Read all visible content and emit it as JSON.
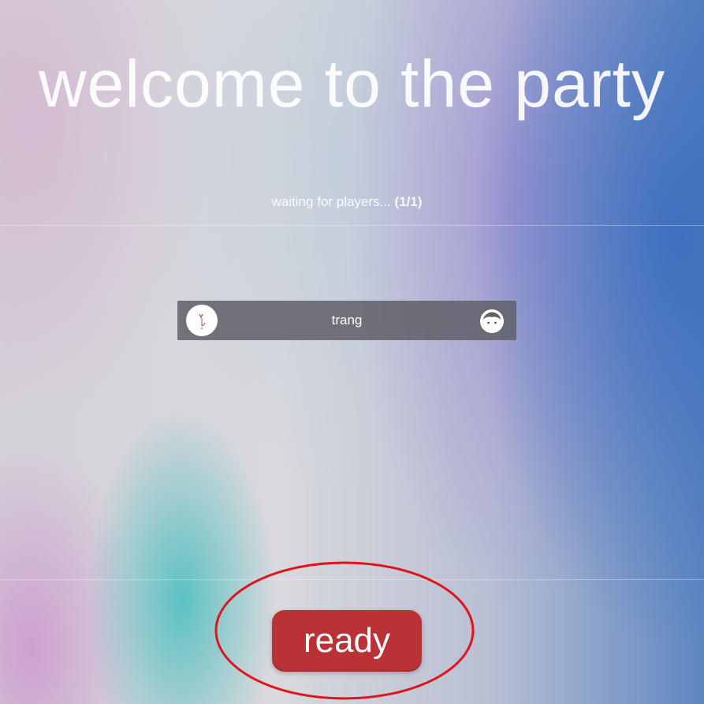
{
  "page": {
    "title": "welcome to the party"
  },
  "lobby": {
    "status_text": "waiting for players...",
    "player_count": "(1/1)"
  },
  "players": [
    {
      "name": "trang",
      "avatar_icon": "user-avatar-image",
      "role_icon": "face-icon"
    }
  ],
  "actions": {
    "ready_label": "ready"
  },
  "colors": {
    "ready_button": "#b83236",
    "highlight_ring": "#e0141e",
    "player_card": "#5f5f69"
  }
}
